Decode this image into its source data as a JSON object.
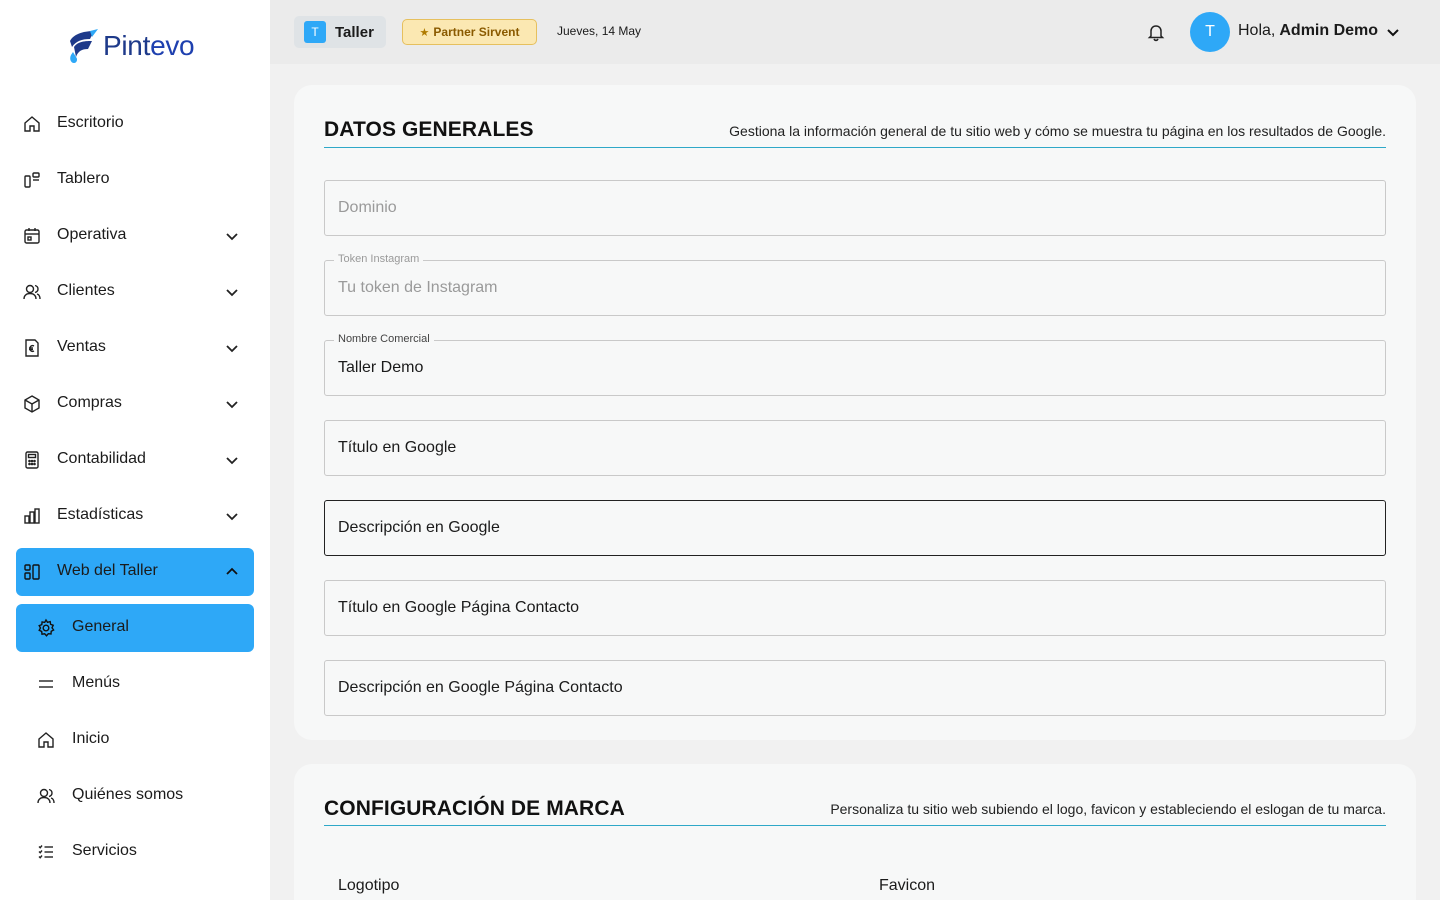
{
  "brand": {
    "logo_text_a": "Pint",
    "logo_text_b": "evo"
  },
  "sidebar": {
    "items": [
      {
        "label": "Escritorio"
      },
      {
        "label": "Tablero"
      },
      {
        "label": "Operativa"
      },
      {
        "label": "Clientes"
      },
      {
        "label": "Ventas"
      },
      {
        "label": "Compras"
      },
      {
        "label": "Contabilidad"
      },
      {
        "label": "Estadísticas"
      },
      {
        "label": "Web del Taller"
      }
    ],
    "sub_items": [
      {
        "label": "General"
      },
      {
        "label": "Menús"
      },
      {
        "label": "Inicio"
      },
      {
        "label": "Quiénes somos"
      },
      {
        "label": "Servicios"
      }
    ]
  },
  "topbar": {
    "workspace_badge": "T",
    "workspace_name": "Taller",
    "partner_label": "Partner Sirvent",
    "date": "Jueves, 14 May",
    "avatar_initial": "T",
    "greeting": "Hola,",
    "user_name": "Admin Demo"
  },
  "general": {
    "title": "DATOS GENERALES",
    "description": "Gestiona la información general de tu sitio web y cómo se muestra tu página en los resultados de Google.",
    "fields": {
      "dominio": {
        "placeholder": "Dominio"
      },
      "token": {
        "label": "Token Instagram",
        "placeholder": "Tu token de Instagram"
      },
      "nombre": {
        "label": "Nombre Comercial",
        "value": "Taller Demo"
      },
      "titulo_google": {
        "value": "Título en Google"
      },
      "descripcion_google": {
        "value": "Descripción en Google"
      },
      "titulo_contacto": {
        "value": "Título en Google Página Contacto"
      },
      "descripcion_contacto": {
        "value": "Descripción en Google Página Contacto"
      }
    }
  },
  "marca": {
    "title": "CONFIGURACIÓN DE MARCA",
    "description": "Personaliza tu sitio web subiendo el logo, favicon y estableciendo el eslogan de tu marca.",
    "logo_label": "Logotipo",
    "favicon_label": "Favicon"
  },
  "colors": {
    "accent": "#2ea8f7",
    "partner_bg": "#fbe8b2",
    "rule": "#2ea8c8"
  }
}
